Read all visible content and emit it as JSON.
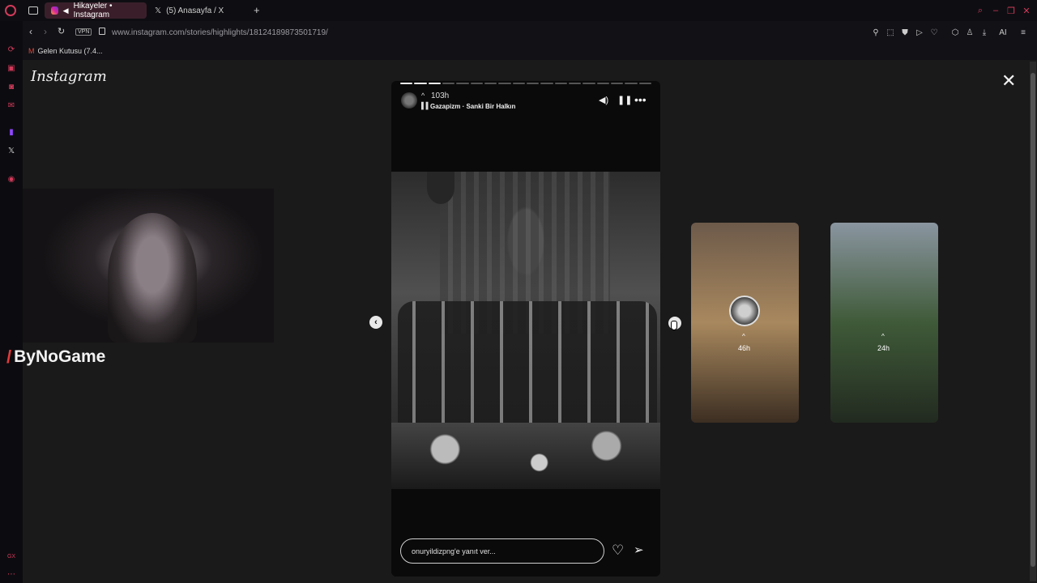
{
  "browser": {
    "tabs": [
      {
        "label": "Hikayeler • Instagram",
        "active": true
      },
      {
        "label": "(5) Anasayfa / X",
        "active": false
      }
    ],
    "address": "www.instagram.com/stories/highlights/18124189873501719/",
    "vpn_label": "VPN",
    "ai_label": "AI",
    "bookmark": "Gelen Kutusu (7.4..."
  },
  "instagram": {
    "logo": "Instagram",
    "close_icon": "close-icon",
    "story": {
      "segments_total": 18,
      "segments_done": 3,
      "time": "103h",
      "song": "Gazapizm · Sanki Bir Halkın",
      "reply_placeholder": "onuryildizpng'e yanıt ver..."
    },
    "previews": [
      {
        "time": "46h",
        "colors": [
          "#6d5a4a",
          "#a8885e",
          "#3c2e22"
        ]
      },
      {
        "time": "24h",
        "colors": [
          "#8a95a0",
          "#3f5a38",
          "#222a20"
        ]
      }
    ]
  },
  "overlay": {
    "brand": "ByNoGame"
  },
  "colors": {
    "accent": "#d23a5a",
    "tab_active": "#3a1f2a"
  }
}
